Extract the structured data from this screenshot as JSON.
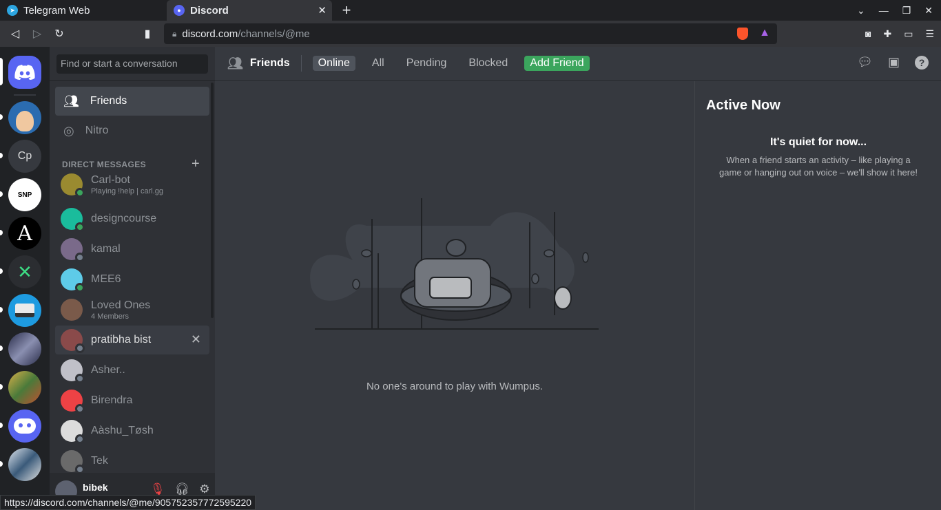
{
  "browser": {
    "tabs": [
      {
        "title": "Telegram Web",
        "active": false
      },
      {
        "title": "Discord",
        "active": true
      }
    ],
    "url_domain": "discord.com",
    "url_path": "/channels/@me",
    "status_url": "https://discord.com/channels/@me/905752357772595220"
  },
  "guilds": [
    {
      "name": "Home",
      "initials": "",
      "color": "#5865f2"
    },
    {
      "name": "user-avatar",
      "initials": "",
      "color": "#2b6cb0"
    },
    {
      "name": "Cp",
      "initials": "Cp",
      "color": "#36393f"
    },
    {
      "name": "SNP",
      "initials": "SNP",
      "color": "#ffffff"
    },
    {
      "name": "A",
      "initials": "A",
      "color": "#202225"
    },
    {
      "name": "X",
      "initials": "✕",
      "color": "#2b2d31"
    },
    {
      "name": "typewriter",
      "initials": "",
      "color": "#1e9be0"
    },
    {
      "name": "anime1",
      "initials": "",
      "color": "#5b5f8a"
    },
    {
      "name": "anime2",
      "initials": "",
      "color": "#7a9a4a"
    },
    {
      "name": "bot",
      "initials": "",
      "color": "#5865f2"
    },
    {
      "name": "anime3",
      "initials": "",
      "color": "#4a6a8a"
    }
  ],
  "sidebar": {
    "search_placeholder": "Find or start a conversation",
    "nav": [
      {
        "label": "Friends",
        "selected": true
      },
      {
        "label": "Nitro",
        "selected": false
      }
    ],
    "dm_header": "DIRECT MESSAGES",
    "dms": [
      {
        "name": "Carl-bot",
        "sub": "Playing !help | carl.gg",
        "color": "#9a8a30",
        "status": "online"
      },
      {
        "name": "designcourse",
        "sub": "",
        "color": "#1abc9c",
        "status": "online"
      },
      {
        "name": "kamal",
        "sub": "",
        "color": "#7a6a8a",
        "status": "offline"
      },
      {
        "name": "MEE6",
        "sub": "",
        "color": "#5ecbe8",
        "status": "online"
      },
      {
        "name": "Loved Ones",
        "sub": "4 Members",
        "color": "#7a5a4a",
        "status": ""
      },
      {
        "name": "pratibha bist",
        "sub": "",
        "color": "#8a4a4a",
        "status": "offline",
        "selected": true
      },
      {
        "name": "Asher..",
        "sub": "",
        "color": "#c0c0c8",
        "status": "offline"
      },
      {
        "name": "Birendra",
        "sub": "",
        "color": "#ed4245",
        "status": "offline"
      },
      {
        "name": "Aàshu_Tøsh",
        "sub": "",
        "color": "#dcdcdc",
        "status": "offline"
      },
      {
        "name": "Tek",
        "sub": "",
        "color": "#6a6a6a",
        "status": "offline"
      }
    ],
    "user": {
      "name": "bibek"
    }
  },
  "header": {
    "title": "Friends",
    "tabs": [
      "Online",
      "All",
      "Pending",
      "Blocked"
    ],
    "add_friend": "Add Friend"
  },
  "main": {
    "empty_text": "No one's around to play with Wumpus."
  },
  "active_now": {
    "title": "Active Now",
    "quiet": "It's quiet for now...",
    "desc": "When a friend starts an activity – like playing a game or hanging out on voice – we'll show it here!"
  }
}
